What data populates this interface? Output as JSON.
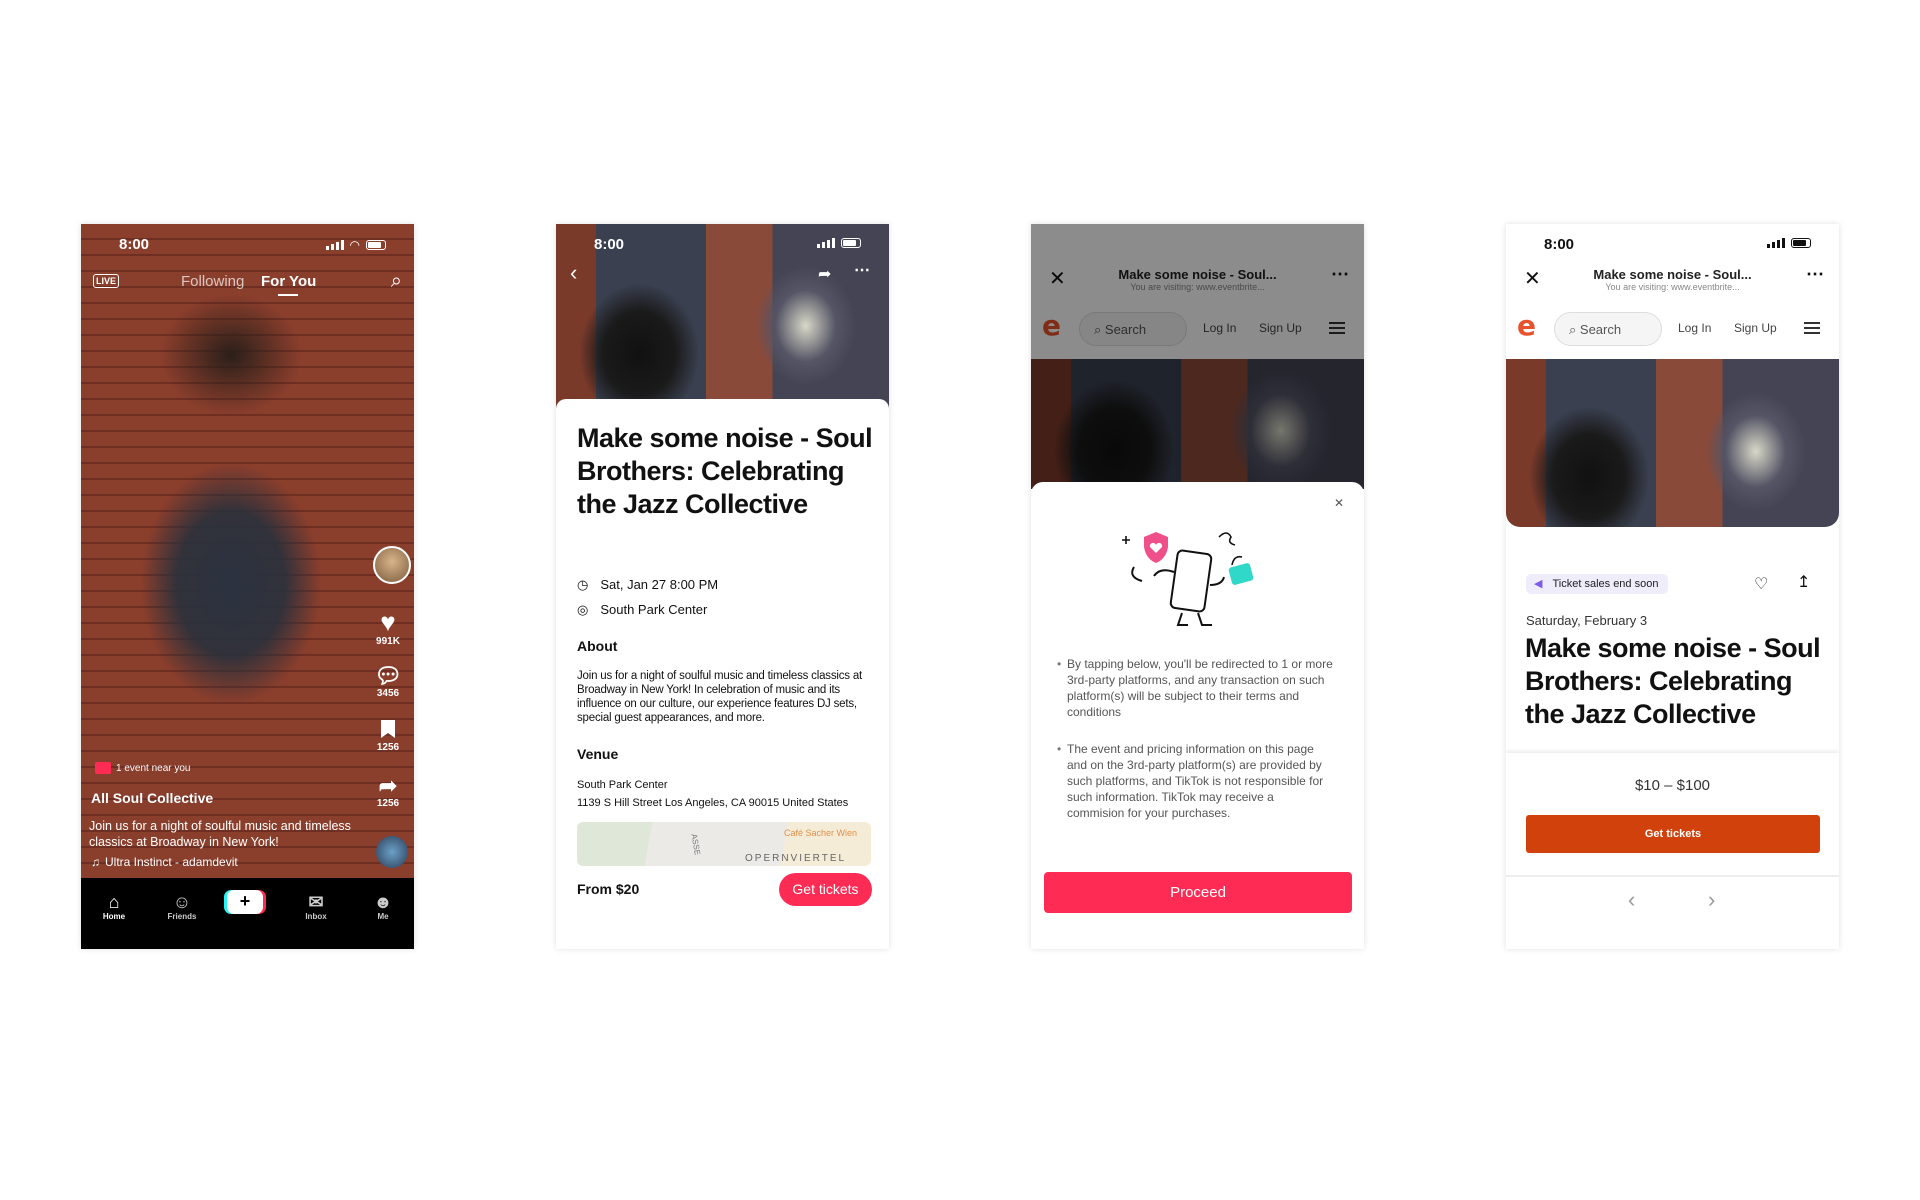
{
  "tiktok": {
    "time": "8:00",
    "live_label": "LIVE",
    "tabs": [
      "Following",
      "For You"
    ],
    "active_tab": "For You",
    "likes": "991K",
    "comments": "3456",
    "saves": "1256",
    "shares": "1256",
    "event_badge": "1 event near you",
    "account": "All Soul Collective",
    "caption": "Join us for a night of soulful music and timeless classics at Broadway in New York!",
    "sound": "Ultra Instinct - adamdevit",
    "nav": [
      "Home",
      "Friends",
      "",
      "Inbox",
      "Me"
    ],
    "accent": "#fe2c55"
  },
  "event_panel": {
    "time": "8:00",
    "title": "Make some noise - Soul Brothers: Celebrating the Jazz Collective",
    "date": "Sat, Jan 27 8:00 PM",
    "location": "South Park Center",
    "about_heading": "About",
    "about": "Join us for a night of soulful music and timeless classics at Broadway in New York! In celebration of music and its influence on our culture, our experience features DJ sets, special guest appearances, and more.",
    "venue_heading": "Venue",
    "venue_name": "South Park Center",
    "venue_address": "1139 S Hill Street Los Angeles, CA 90015 United States",
    "map_labels": [
      "Café Sacher Wien",
      "OPERNVIERTEL",
      "ASSE"
    ],
    "price": "From $20",
    "cta": "Get tickets",
    "cta_color": "#fe2c55"
  },
  "redirect": {
    "page_title": "Make some noise - Soul...",
    "visiting": "You are visiting: www.eventbrite...",
    "search_placeholder": "Search",
    "login": "Log In",
    "signup": "Sign Up",
    "bullets": [
      "By tapping below, you'll be redirected to 1 or more 3rd-party platforms, and any transaction on such platform(s) will be subject to their terms and conditions",
      "The event and pricing information on this page and on the 3rd-party platform(s) are provided by such platforms, and TikTok is not responsible for such information. TikTok may receive a commision for your purchases."
    ],
    "proceed": "Proceed"
  },
  "eventbrite": {
    "time": "8:00",
    "page_title": "Make some noise - Soul...",
    "visiting": "You are visiting: www.eventbrite...",
    "search_placeholder": "Search",
    "login": "Log In",
    "signup": "Sign Up",
    "badge": "Ticket sales end soon",
    "date": "Saturday, February 3",
    "title": "Make some noise - Soul Brothers: Celebrating the Jazz Collective",
    "price_range": "$10 – $100",
    "cta": "Get tickets",
    "cta_color": "#d1410c",
    "brand_color": "#e8522b"
  }
}
